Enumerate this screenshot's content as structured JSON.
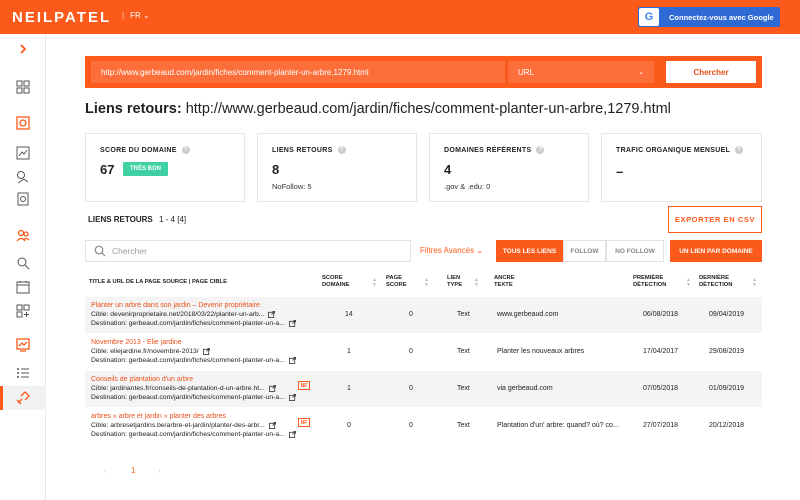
{
  "header": {
    "logo": "NEILPATEL",
    "lang": "FR",
    "google_btn": "Connectez-vous avec Google",
    "google_letter": "G"
  },
  "search": {
    "url_value": "http://www.gerbeaud.com/jardin/fiches/comment-planter-un-arbre,1279.html",
    "mode": "URL",
    "button": "Chercher"
  },
  "page": {
    "title_label": "Liens retours:",
    "title_url": "http://www.gerbeaud.com/jardin/fiches/comment-planter-un-arbre,1279.html"
  },
  "cards": [
    {
      "title": "SCORE DU DOMAINE",
      "value": "67",
      "badge": "TRÈS BON",
      "sub": ""
    },
    {
      "title": "LIENS RETOURS",
      "value": "8",
      "badge": "",
      "sub": "NoFollow: 5"
    },
    {
      "title": "DOMAINES RÉFÉRENTS",
      "value": "4",
      "badge": "",
      "sub": ".gov & .edu: 0"
    },
    {
      "title": "TRAFIC ORGANIQUE MENSUEL",
      "value": "–",
      "badge": "",
      "sub": ""
    }
  ],
  "backlinks": {
    "label": "LIENS RETOURS",
    "range": "1 - 4 [4]",
    "export": "EXPORTER EN CSV",
    "search_placeholder": "Chercher",
    "advanced_filters": "Filtres Avancés",
    "filters": [
      "TOUS LES LIENS",
      "FOLLOW",
      "NO FOLLOW",
      "UN LIEN PAR DOMAINE"
    ]
  },
  "table": {
    "headers": {
      "title": "TITLE & URL DE LA PAGE SOURCE | PAGE CIBLE",
      "domain_score": [
        "SCORE",
        "DOMAINE"
      ],
      "page_score": [
        "PAGE",
        "SCORE"
      ],
      "link_type": [
        "LIEN",
        "TYPE"
      ],
      "anchor": [
        "ANCRE",
        "TEXTE"
      ],
      "first_seen": [
        "PREMIÈRE",
        "DÉTECTION"
      ],
      "last_seen": [
        "DERNIÈRE",
        "DÉTECTION"
      ]
    },
    "rows": [
      {
        "title": "Planter un arbre dans son jardin – Devenir propriétaire",
        "cible": "Cible: devenirproprietaire.net/2018/03/22/planter-un-arb...",
        "destination": "Destination: gerbeaud.com/jardin/fiches/comment-planter-un-a...",
        "nf": "",
        "domain_score": "14",
        "page_score": "0",
        "type": "Text",
        "anchor": "www.gerbeaud.com",
        "first": "06/08/2018",
        "last": "09/04/2019"
      },
      {
        "title": "Novembre 2013 - Elie jardine",
        "cible": "Cible: eliejardine.fr/novembre-2013/",
        "destination": "Destination: gerbeaud.com/jardin/fiches/comment-planter-un-a...",
        "nf": "",
        "domain_score": "1",
        "page_score": "0",
        "type": "Text",
        "anchor": "Planter les nouveaux arbres",
        "first": "17/04/2017",
        "last": "29/08/2019"
      },
      {
        "title": "Conseils de plantation d'un arbre",
        "cible": "Cible: jardinantes.fr/conseils-de-plantation-d-un-arbre.ht...",
        "destination": "Destination: gerbeaud.com/jardin/fiches/comment-planter-un-a...",
        "nf": "NF",
        "domain_score": "1",
        "page_score": "0",
        "type": "Text",
        "anchor": "via gerbeaud.com",
        "first": "07/05/2018",
        "last": "01/09/2019"
      },
      {
        "title": "arbres » arbre et jardin » planter des arbres",
        "cible": "Cible: arbresetjardins.be/arbre-et-jardin/planter-des-arbr...",
        "destination": "Destination: gerbeaud.com/jardin/fiches/comment-planter-un-a...",
        "nf": "NF",
        "domain_score": "0",
        "page_score": "0",
        "type": "Text",
        "anchor": "Plantation d'un' arbre: quand? où? co...",
        "first": "27/07/2018",
        "last": "20/12/2018"
      }
    ]
  },
  "pagination": {
    "prev": "‹",
    "current": "1",
    "next": "›"
  },
  "colors": {
    "brand": "#fb5a1a",
    "good_badge": "#3fd1a3",
    "google_blue": "#2f6ad4"
  }
}
